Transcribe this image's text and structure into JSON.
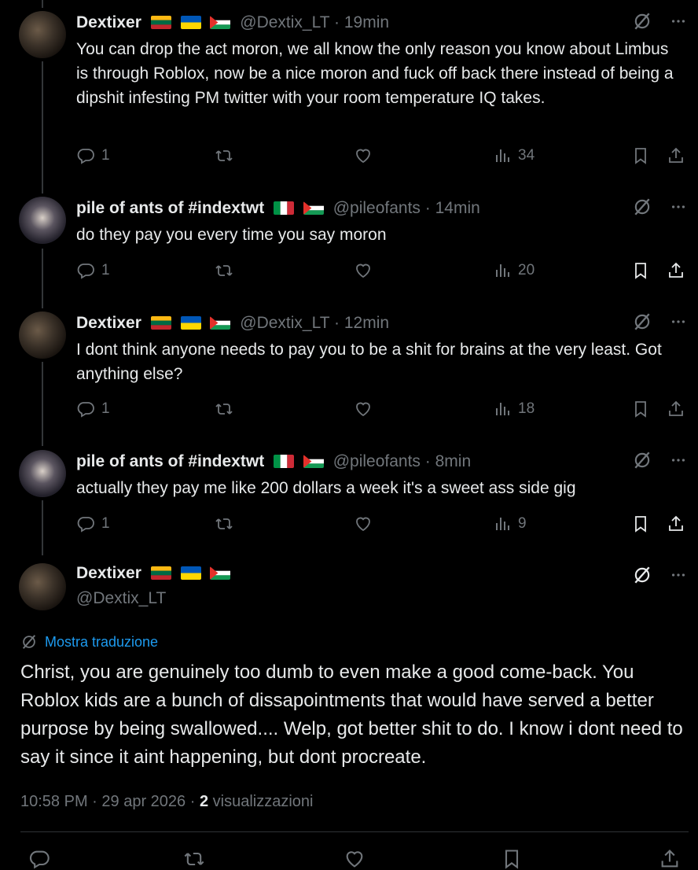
{
  "tweets": [
    {
      "name": "Dextixer",
      "handle": "@Dextix_LT",
      "time": "19min",
      "text": "You can drop the act moron, we all know the only reason you know about Limbus is through Roblox, now be a nice moron and fuck off back there instead of being a dipshit infesting PM twitter with your room temperature IQ takes.",
      "replies": "1",
      "views": "34",
      "flags": [
        "lithuania",
        "ukraine",
        "palestine"
      ]
    },
    {
      "name": "pile of ants of #indextwt",
      "handle": "@pileofants",
      "time": "14min",
      "text": "do they pay you every time you say moron",
      "replies": "1",
      "views": "20",
      "flags": [
        "italy",
        "palestine"
      ]
    },
    {
      "name": "Dextixer",
      "handle": "@Dextix_LT",
      "time": "12min",
      "text": "I dont think anyone needs to pay you to be a shit for brains at the very least. Got anything else?",
      "replies": "1",
      "views": "18",
      "flags": [
        "lithuania",
        "ukraine",
        "palestine"
      ]
    },
    {
      "name": "pile of ants of #indextwt",
      "handle": "@pileofants",
      "time": "8min",
      "text": "actually they pay me like 200 dollars a week it's a sweet ass side gig",
      "replies": "1",
      "views": "9",
      "flags": [
        "italy",
        "palestine"
      ]
    }
  ],
  "separator": "·",
  "main_tweet": {
    "name": "Dextixer",
    "handle": "@Dextix_LT",
    "translate_label": "Mostra traduzione",
    "text": "Christ, you are genuinely too dumb to even make a good come-back. You Roblox kids are a bunch of dissapointments that would have served a better purpose by being swallowed.... Welp, got better shit to do. I know i dont need to say it since it aint happening, but dont procreate.",
    "time": "10:58 PM",
    "date": "29 apr 2026",
    "views_count": "2",
    "views_label": "visualizzazioni"
  },
  "colors": {
    "background": "#000000",
    "text": "#e7e9ea",
    "muted": "#71767b",
    "link": "#1d9bf0",
    "divider": "#2f3336"
  },
  "icons": [
    "reply-icon",
    "retweet-icon",
    "like-icon",
    "views-icon",
    "bookmark-icon",
    "share-icon",
    "grok-icon",
    "more-icon"
  ]
}
